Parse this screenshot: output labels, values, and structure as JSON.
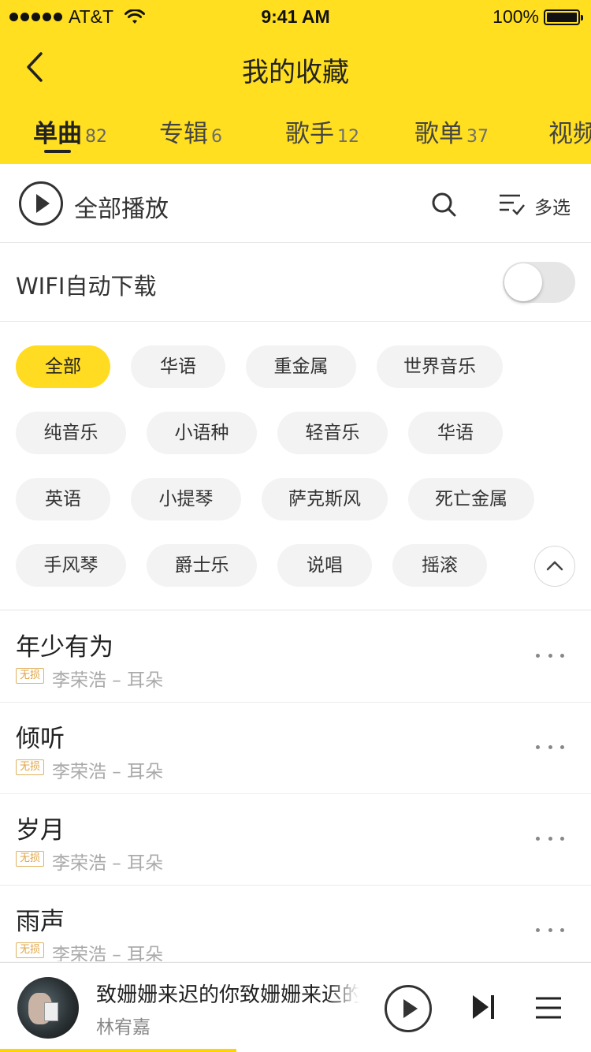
{
  "status": {
    "carrier": "AT&T",
    "time": "9:41 AM",
    "battery": "100%"
  },
  "nav": {
    "title": "我的收藏"
  },
  "tabs": [
    {
      "label": "单曲",
      "count": "82",
      "active": true
    },
    {
      "label": "专辑",
      "count": "6"
    },
    {
      "label": "歌手",
      "count": "12"
    },
    {
      "label": "歌单",
      "count": "37"
    },
    {
      "label": "视频",
      "count": ""
    }
  ],
  "toolbar": {
    "play_all": "全部播放",
    "multi_select": "多选"
  },
  "wifi": {
    "label": "WIFI自动下载",
    "enabled": false
  },
  "tags": [
    "全部",
    "华语",
    "重金属",
    "世界音乐",
    "纯音乐",
    "小语种",
    "轻音乐",
    "华语",
    "英语",
    "小提琴",
    "萨克斯风",
    "死亡金属",
    "手风琴",
    "爵士乐",
    "说唱",
    "摇滚"
  ],
  "songs": [
    {
      "title": "年少有为",
      "quality": "无损",
      "meta": "李荣浩 – 耳朵"
    },
    {
      "title": "倾听",
      "quality": "无损",
      "meta": "李荣浩 – 耳朵"
    },
    {
      "title": "岁月",
      "quality": "无损",
      "meta": "李荣浩 – 耳朵"
    },
    {
      "title": "雨声",
      "quality": "无损",
      "meta": "李荣浩 – 耳朵"
    }
  ],
  "player": {
    "song": "致姗姗来迟的你致姗姗来迟的你",
    "artist": "林宥嘉",
    "progress": 0.4
  },
  "colors": {
    "accent": "#ffdf1f",
    "tag_active": "#ffdb22",
    "quality": "#e0a445"
  }
}
